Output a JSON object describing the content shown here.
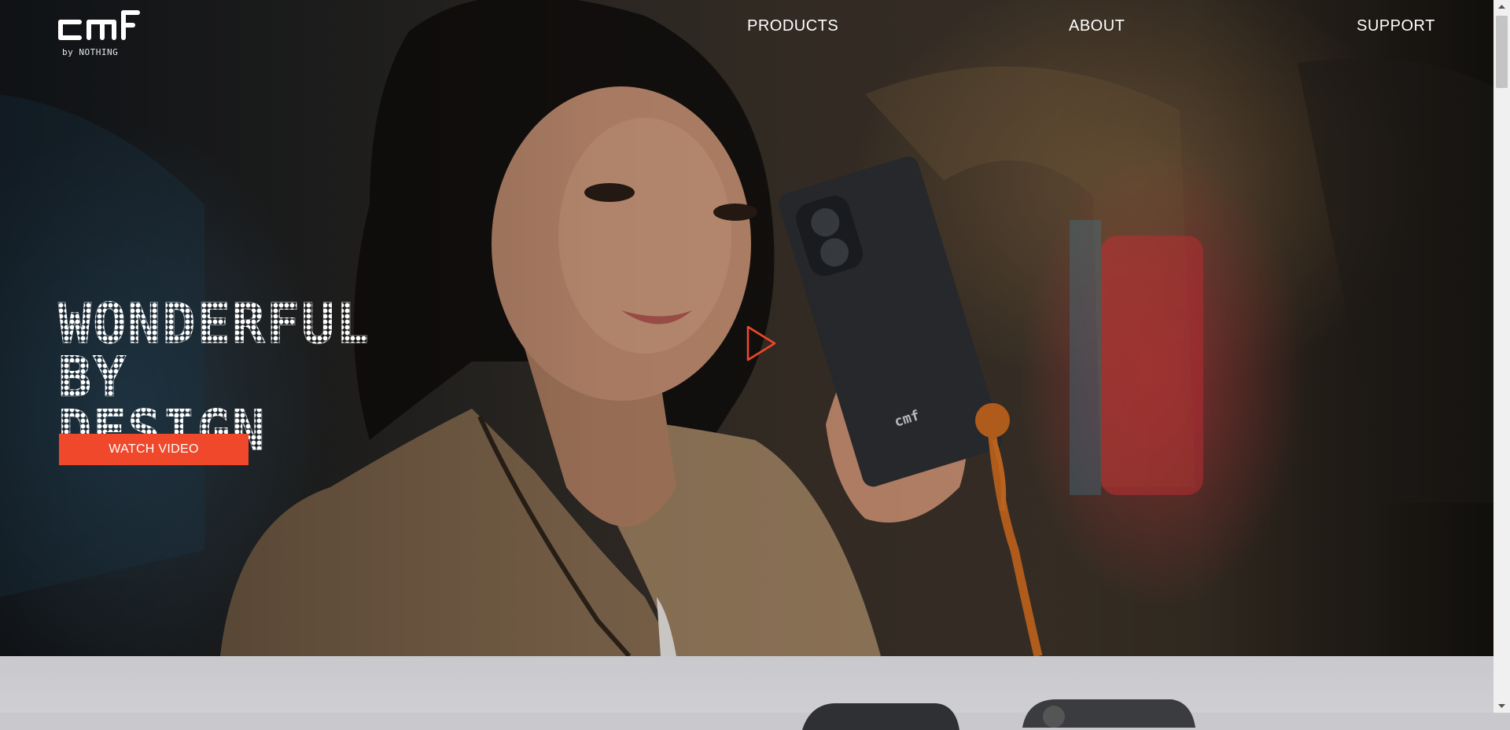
{
  "brand": {
    "logo_text": "cmf",
    "sub_text": "by NOTHING"
  },
  "nav": {
    "products": "PRODUCTS",
    "about": "ABOUT",
    "support": "SUPPORT"
  },
  "hero": {
    "headline_line1": "WONDERFUL BY",
    "headline_line2": "DESIGN",
    "cta_label": "WATCH VIDEO",
    "play_icon": "play-icon"
  },
  "colors": {
    "accent": "#f0482a",
    "text_light": "#ffffff",
    "lower_bg": "#c9c9cd"
  }
}
